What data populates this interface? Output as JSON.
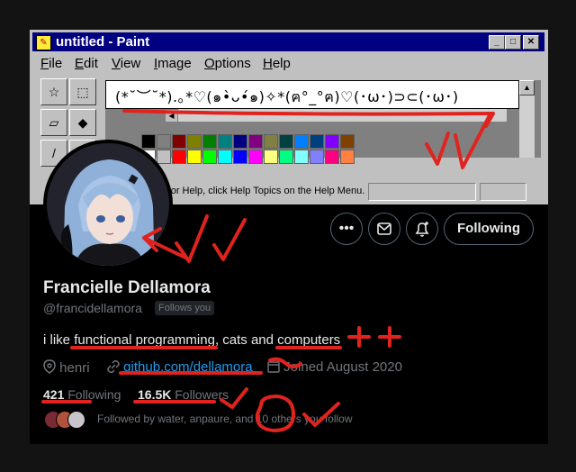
{
  "paint": {
    "title": "untitled - Paint",
    "menu": [
      "File",
      "Edit",
      "View",
      "Image",
      "Options",
      "Help"
    ],
    "canvas_text": "(*˘︶˘*).｡*♡(๑•̀ᴗ•́๑)✧*(ฅ°_°ฅ)♡(･ω･)⊃⊂(･ω･)",
    "status": "For Help, click Help Topics on the Help Menu."
  },
  "actions": {
    "more": "•••",
    "message_icon": "mail-icon",
    "notify_icon": "bell-plus-icon",
    "follow_label": "Following"
  },
  "profile": {
    "name": "Francielle Dellamora",
    "handle": "@francidellamora",
    "follows_you": "Follows you",
    "bio": {
      "prefix": "i like ",
      "hl1": "functional programming",
      "mid": ", cats and ",
      "hl2": "computers"
    },
    "location": "henri",
    "website": "github.com/dellamora",
    "joined": "Joined August 2020"
  },
  "stats": {
    "following_count": "421",
    "following_label": "Following",
    "followers_count": "16.5K",
    "followers_label": "Followers"
  },
  "followed_by": "Followed by water, anpaure, and 10 others you follow",
  "colors": {
    "accent": "#1d9bf0",
    "ink": "#e0231e",
    "paint_title": "#000080"
  }
}
